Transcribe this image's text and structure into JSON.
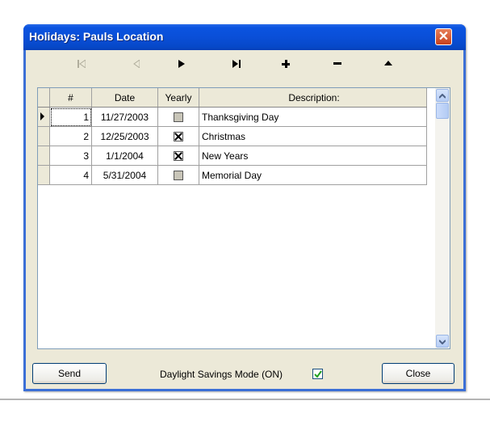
{
  "window": {
    "title": "Holidays: Pauls Location"
  },
  "toolbar": {
    "first": "first-record",
    "prev": "previous-record",
    "next": "next-record",
    "last": "last-record",
    "add": "add-record",
    "remove": "remove-record",
    "up": "move-up"
  },
  "grid": {
    "columns": {
      "num": "#",
      "date": "Date",
      "yearly": "Yearly",
      "description": "Description:"
    },
    "rows": [
      {
        "num": "1",
        "date": "11/27/2003",
        "yearly": false,
        "description": "Thanksgiving Day"
      },
      {
        "num": "2",
        "date": "12/25/2003",
        "yearly": true,
        "description": "Christmas"
      },
      {
        "num": "3",
        "date": "1/1/2004",
        "yearly": true,
        "description": "New Years"
      },
      {
        "num": "4",
        "date": "5/31/2004",
        "yearly": false,
        "description": "Memorial Day"
      }
    ]
  },
  "footer": {
    "send_label": "Send",
    "dst_label": "Daylight Savings Mode (ON)",
    "dst_checked": true,
    "close_label": "Close"
  },
  "colors": {
    "titlebar": "#0a4fd8",
    "client": "#ece9d8",
    "close_button": "#d9542c"
  }
}
